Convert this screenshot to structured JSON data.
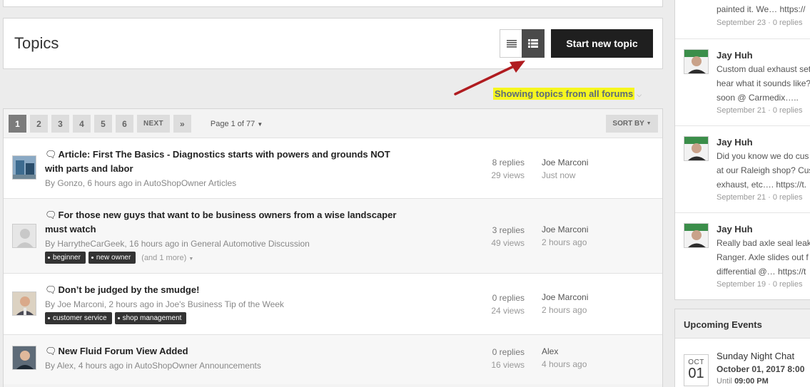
{
  "topics": {
    "title": "Topics",
    "start_button": "Start new topic",
    "showing_filter": "Showing topics from all forums",
    "pagination": {
      "pages": [
        "1",
        "2",
        "3",
        "4",
        "5",
        "6"
      ],
      "next": "NEXT",
      "last": "»",
      "page_of": "Page 1 of 77",
      "sort_by": "SORT BY"
    },
    "rows": [
      {
        "title_line1": "Article: First The Basics - Diagnostics starts with powers and grounds NOT",
        "title_line2": "with parts and labor",
        "by": "By ",
        "author": "Gonzo",
        "time": ", 6 hours ago in ",
        "forum": "AutoShopOwner Articles",
        "replies": "8 replies",
        "views": "29 views",
        "last_user": "Joe Marconi",
        "last_time": "Just now",
        "tags": []
      },
      {
        "title_line1": "For those new guys that want to be business owners from a wise landscaper",
        "title_line2": "must watch",
        "by": "By ",
        "author": "HarrytheCarGeek",
        "time": ", 16 hours ago in ",
        "forum": "General Automotive Discussion",
        "replies": "3 replies",
        "views": "49 views",
        "last_user": "Joe Marconi",
        "last_time": "2 hours ago",
        "tags": [
          "beginner",
          "new owner"
        ],
        "more_tags": "(and 1 more)"
      },
      {
        "title_line1": "Don’t be judged by the smudge!",
        "title_line2": "",
        "by": "By ",
        "author": "Joe Marconi",
        "time": ", 2 hours ago in ",
        "forum": "Joe's Business Tip of the Week",
        "replies": "0 replies",
        "views": "24 views",
        "last_user": "Joe Marconi",
        "last_time": "2 hours ago",
        "tags": [
          "customer service",
          "shop management"
        ]
      },
      {
        "title_line1": "New Fluid Forum View Added",
        "title_line2": "",
        "by": "By ",
        "author": "Alex",
        "time": ", 4 hours ago in ",
        "forum": "AutoShopOwner Announcements",
        "replies": "0 replies",
        "views": "16 views",
        "last_user": "Alex",
        "last_time": "4 hours ago",
        "tags": []
      }
    ]
  },
  "sidebar": {
    "feed": [
      {
        "name": "",
        "text": "painted it. We… https://",
        "meta": "September 23 · 0 replies"
      },
      {
        "name": "Jay Huh",
        "text": "Custom dual exhaust set\nhear what it sounds like?\nsoon @ Carmedix…..",
        "meta": "September 21 · 0 replies"
      },
      {
        "name": "Jay Huh",
        "text": "Did you know we do cus\nat our Raleigh shop? Cus\nexhaust, etc…. https://t.",
        "meta": "September 21 · 0 replies"
      },
      {
        "name": "Jay Huh",
        "text": "Really bad axle seal leak\nRanger. Axle slides out f\ndifferential @… https://t",
        "meta": "September 19 · 0 replies"
      }
    ],
    "events": {
      "header": "Upcoming Events",
      "month": "OCT",
      "day": "01",
      "title": "Sunday Night Chat",
      "when": "October 01, 2017 8:00",
      "until_label": "Until ",
      "until_time": "09:00 PM"
    }
  },
  "icons": {
    "list_view": "list-view-icon",
    "grid_view": "grid-view-icon",
    "topic": "speech-bubbles-icon",
    "dropdown": "chevron-down-icon"
  },
  "colors": {
    "highlight": "#f6f61f",
    "button_dark": "#1f1f1f",
    "annotation_arrow": "#b01c20",
    "active_page": "#7c7c7c"
  }
}
